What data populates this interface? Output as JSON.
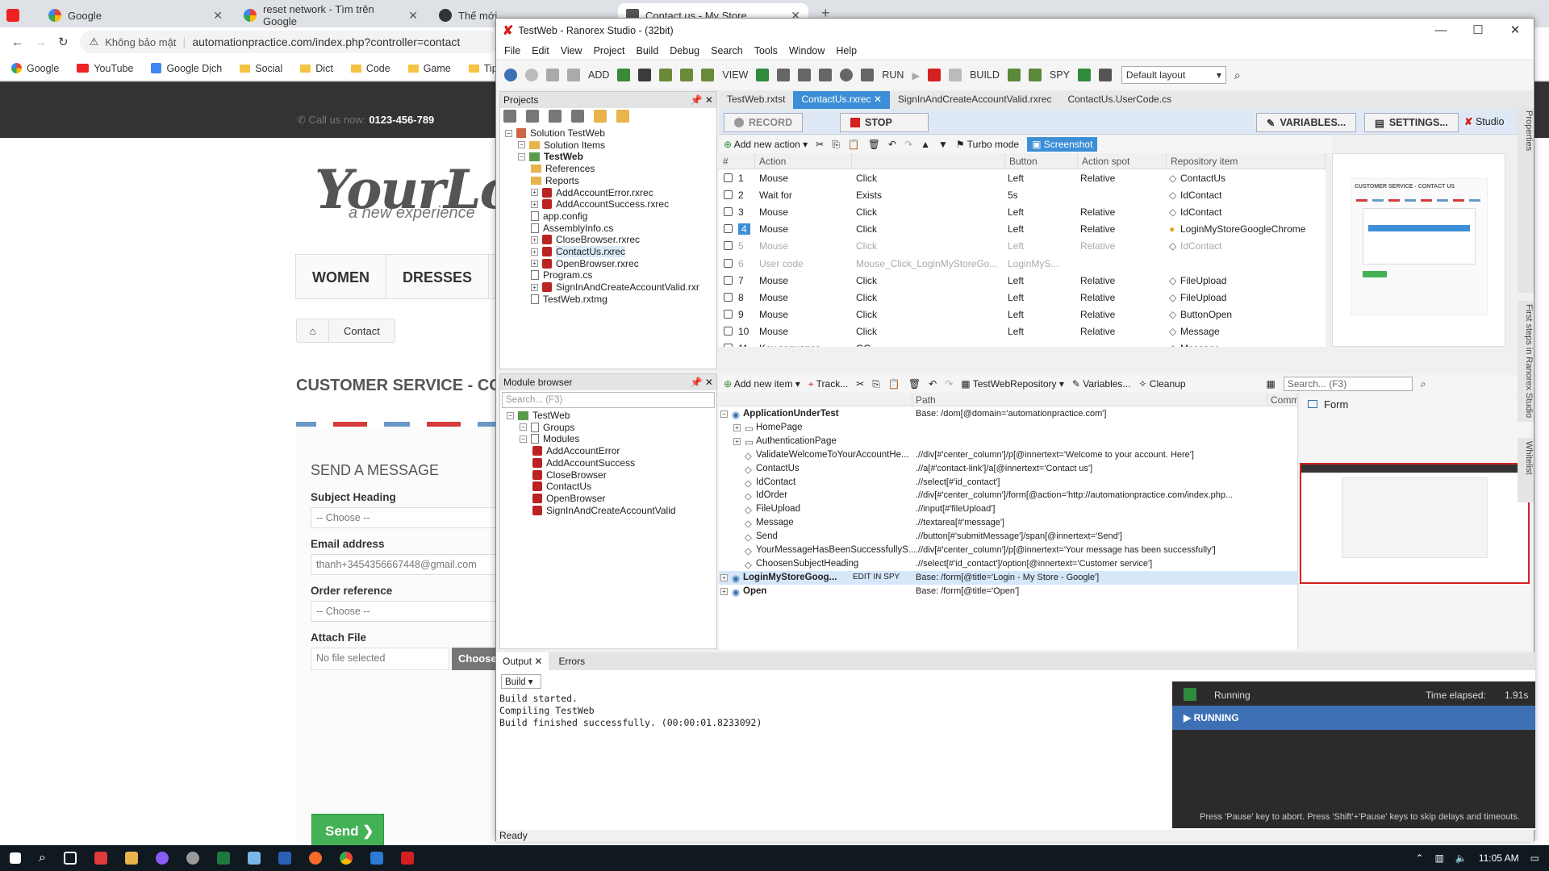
{
  "browser": {
    "tabs": [
      {
        "label": "Google",
        "active": false
      },
      {
        "label": "reset network - Tìm trên Google",
        "active": false
      },
      {
        "label": "Thế mới",
        "active": false
      },
      {
        "label": "Contact us - My Store",
        "active": true
      }
    ],
    "security_label": "Không bảo mật",
    "url": "automationpractice.com/index.php?controller=contact",
    "bookmarks": [
      "Google",
      "YouTube",
      "Google Dịch",
      "Social",
      "Dict",
      "Code",
      "Game",
      "Tips"
    ]
  },
  "site": {
    "call_label": "Call us now:",
    "phone": "0123-456-789",
    "logo": "YourLo",
    "logo_sub": "a new experience",
    "menu": [
      "WOMEN",
      "DRESSES"
    ],
    "breadcrumb": "Contact",
    "section_title": "CUSTOMER SERVICE - CONTA",
    "form": {
      "heading": "SEND A MESSAGE",
      "subject_label": "Subject Heading",
      "subject_value": "-- Choose --",
      "email_label": "Email address",
      "email_value": "thanh+3454356667448@gmail.com",
      "order_label": "Order reference",
      "order_value": "-- Choose --",
      "attach_label": "Attach File",
      "file_value": "No file selected",
      "choose_label": "Choose",
      "send_label": "Send ❯"
    }
  },
  "ranorex": {
    "title": "TestWeb - Ranorex Studio - (32bit)",
    "menu": [
      "File",
      "Edit",
      "View",
      "Project",
      "Build",
      "Debug",
      "Search",
      "Tools",
      "Window",
      "Help"
    ],
    "toolbar": {
      "add": "ADD",
      "view": "VIEW",
      "run": "RUN",
      "build": "BUILD",
      "spy": "SPY",
      "layout": "Default layout"
    },
    "projects_title": "Projects",
    "project_tree": [
      {
        "label": "Solution TestWeb",
        "indent": 0,
        "icon": "sol"
      },
      {
        "label": "Solution Items",
        "indent": 1,
        "icon": "fold"
      },
      {
        "label": "TestWeb",
        "indent": 1,
        "icon": "proj"
      },
      {
        "label": "References",
        "indent": 2,
        "icon": "fold"
      },
      {
        "label": "Reports",
        "indent": 2,
        "icon": "fold"
      },
      {
        "label": "AddAccountError.rxrec",
        "indent": 2,
        "icon": "rec"
      },
      {
        "label": "AddAccountSuccess.rxrec",
        "indent": 2,
        "icon": "rec"
      },
      {
        "label": "app.config",
        "indent": 2,
        "icon": "file"
      },
      {
        "label": "AssemblyInfo.cs",
        "indent": 2,
        "icon": "file"
      },
      {
        "label": "CloseBrowser.rxrec",
        "indent": 2,
        "icon": "rec"
      },
      {
        "label": "ContactUs.rxrec",
        "indent": 2,
        "icon": "rec"
      },
      {
        "label": "OpenBrowser.rxrec",
        "indent": 2,
        "icon": "rec"
      },
      {
        "label": "Program.cs",
        "indent": 2,
        "icon": "file"
      },
      {
        "label": "SignInAndCreateAccountValid.rxr",
        "indent": 2,
        "icon": "rec"
      },
      {
        "label": "TestWeb.rxtmg",
        "indent": 2,
        "icon": "file"
      }
    ],
    "module_browser_title": "Module browser",
    "module_search_placeholder": "Search... (F3)",
    "module_tree": [
      {
        "label": "TestWeb",
        "indent": 0
      },
      {
        "label": "Groups",
        "indent": 1
      },
      {
        "label": "Modules",
        "indent": 1
      },
      {
        "label": "AddAccountError",
        "indent": 2
      },
      {
        "label": "AddAccountSuccess",
        "indent": 2
      },
      {
        "label": "CloseBrowser",
        "indent": 2
      },
      {
        "label": "ContactUs",
        "indent": 2
      },
      {
        "label": "OpenBrowser",
        "indent": 2
      },
      {
        "label": "SignInAndCreateAccountValid",
        "indent": 2
      }
    ],
    "doc_tabs": [
      "TestWeb.rxtst",
      "ContactUs.rxrec",
      "SignInAndCreateAccountValid.rxrec",
      "ContactUs.UserCode.cs"
    ],
    "record_label": "RECORD",
    "stop_label": "STOP",
    "variables_label": "VARIABLES...",
    "settings_label": "SETTINGS...",
    "studio_label": "Studio",
    "action_bar": {
      "add_action": "Add new action",
      "turbo": "Turbo mode",
      "screenshot": "Screenshot"
    },
    "action_columns": [
      "#",
      "Action",
      "",
      "Button",
      "Action spot",
      "Repository item"
    ],
    "actions": [
      {
        "n": "1",
        "action": "Mouse",
        "event": "Click",
        "button": "Left",
        "spot": "Relative",
        "item": "ContactUs",
        "disabled": false
      },
      {
        "n": "2",
        "action": "Wait for",
        "event": "Exists",
        "button": "5s",
        "spot": "",
        "item": "IdContact",
        "disabled": false
      },
      {
        "n": "3",
        "action": "Mouse",
        "event": "Click",
        "button": "Left",
        "spot": "Relative",
        "item": "IdContact",
        "disabled": false
      },
      {
        "n": "4",
        "action": "Mouse",
        "event": "Click",
        "button": "Left",
        "spot": "Relative",
        "item": "LoginMyStoreGoogleChrome",
        "disabled": false
      },
      {
        "n": "5",
        "action": "Mouse",
        "event": "Click",
        "button": "Left",
        "spot": "Relative",
        "item": "IdContact",
        "disabled": true
      },
      {
        "n": "6",
        "action": "User code",
        "event": "Mouse_Click_LoginMyStoreGo...",
        "button": "LoginMyS...",
        "spot": "",
        "item": "",
        "disabled": true
      },
      {
        "n": "7",
        "action": "Mouse",
        "event": "Click",
        "button": "Left",
        "spot": "Relative",
        "item": "FileUpload",
        "disabled": false
      },
      {
        "n": "8",
        "action": "Mouse",
        "event": "Click",
        "button": "Left",
        "spot": "Relative",
        "item": "FileUpload",
        "disabled": false
      },
      {
        "n": "9",
        "action": "Mouse",
        "event": "Click",
        "button": "Left",
        "spot": "Relative",
        "item": "ButtonOpen",
        "disabled": false
      },
      {
        "n": "10",
        "action": "Mouse",
        "event": "Click",
        "button": "Left",
        "spot": "Relative",
        "item": "Message",
        "disabled": false
      },
      {
        "n": "11",
        "action": "Key sequence",
        "event": "GG",
        "button": "",
        "spot": "",
        "item": "Message",
        "disabled": false
      }
    ],
    "screenshot_caption": "CUSTOMER SERVICE - CONTACT US",
    "repo_bar": {
      "add_item": "Add new item",
      "track": "Track...",
      "repo": "TestWebRepository",
      "variables": "Variables...",
      "cleanup": "Cleanup",
      "search": "Search... (F3)"
    },
    "repo_columns": [
      "",
      "Path",
      "Comm"
    ],
    "repo_items": [
      {
        "name": "ApplicationUnderTest",
        "path": "Base: /dom[@domain='automationpractice.com']",
        "indent": 0,
        "bold": true
      },
      {
        "name": "HomePage",
        "path": "",
        "indent": 1,
        "bold": false
      },
      {
        "name": "AuthenticationPage",
        "path": "",
        "indent": 1,
        "bold": false
      },
      {
        "name": "ValidateWelcomeToYourAccountHe...",
        "path": ".//div[#'center_column']/p[@innertext='Welcome to your account. Here']",
        "indent": 1,
        "bold": false
      },
      {
        "name": "ContactUs",
        "path": ".//a[#'contact-link']/a[@innertext='Contact us']",
        "indent": 1,
        "bold": false
      },
      {
        "name": "IdContact",
        "path": ".//select[#'id_contact']",
        "indent": 1,
        "bold": false
      },
      {
        "name": "IdOrder",
        "path": ".//div[#'center_column']/form[@action='http://automationpractice.com/index.php...",
        "indent": 1,
        "bold": false
      },
      {
        "name": "FileUpload",
        "path": ".//input[#'fileUpload']",
        "indent": 1,
        "bold": false
      },
      {
        "name": "Message",
        "path": ".//textarea[#'message']",
        "indent": 1,
        "bold": false
      },
      {
        "name": "Send",
        "path": ".//button[#'submitMessage']/span[@innertext='Send']",
        "indent": 1,
        "bold": false
      },
      {
        "name": "YourMessageHasBeenSuccessfullyS...",
        "path": ".//div[#'center_column']/p[@innertext='Your message has been successfully']",
        "indent": 1,
        "bold": false
      },
      {
        "name": "ChoosenSubjectHeading",
        "path": ".//select[#'id_contact']/option[@innertext='Customer service']",
        "indent": 1,
        "bold": false
      },
      {
        "name": "LoginMyStoreGoog...",
        "path": "Base: /form[@title='Login - My Store - Google']",
        "indent": 0,
        "bold": true
      },
      {
        "name": "Open",
        "path": "Base: /form[@title='Open']",
        "indent": 0,
        "bold": true
      }
    ],
    "edit_in_spy": "EDIT IN SPY",
    "form_label": "Form",
    "output_tabs": [
      "Output",
      "Errors"
    ],
    "output_source": "Build",
    "output_lines": "Build started.\nCompiling TestWeb\nBuild finished successfully. (00:00:01.8233092)",
    "runner": {
      "state": "Running",
      "elapsed_label": "Time elapsed:",
      "elapsed": "1.91s",
      "banner": "RUNNING",
      "hint": "Press 'Pause' key to abort. Press 'Shift'+'Pause' keys to skip delays and timeouts."
    },
    "side_tabs": [
      "Properties",
      "First steps in Ranorex Studio",
      "Whitelist"
    ],
    "status": "Ready"
  },
  "taskbar": {
    "time": "11:05 AM"
  }
}
